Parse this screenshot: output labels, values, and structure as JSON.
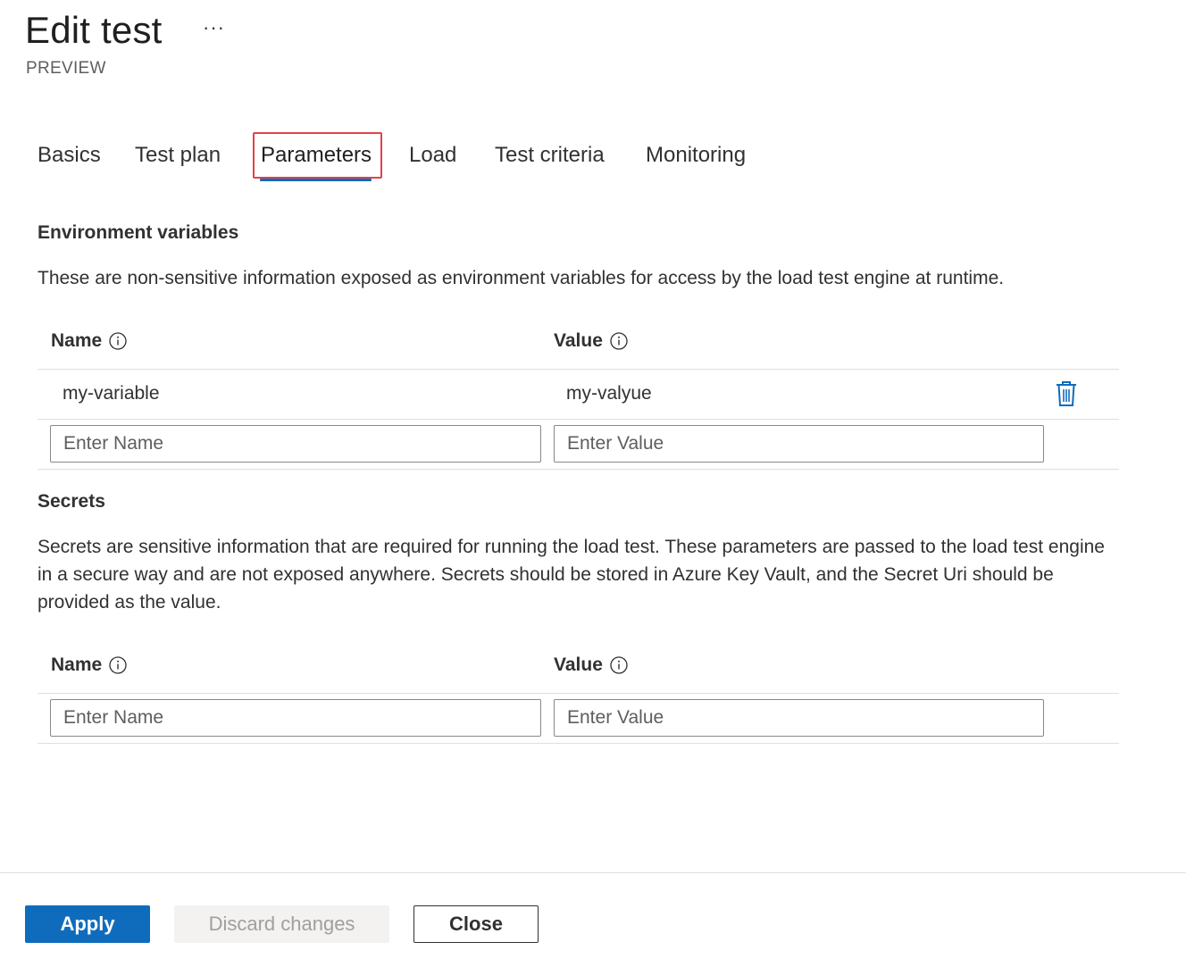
{
  "header": {
    "title": "Edit test",
    "more_label": "···",
    "subtitle": "PREVIEW"
  },
  "tabs": [
    {
      "label": "Basics",
      "active": false
    },
    {
      "label": "Test plan",
      "active": false
    },
    {
      "label": "Parameters",
      "active": true
    },
    {
      "label": "Load",
      "active": false
    },
    {
      "label": "Test criteria",
      "active": false
    },
    {
      "label": "Monitoring",
      "active": false
    }
  ],
  "env": {
    "title": "Environment variables",
    "description": "These are non-sensitive information exposed as environment variables for access by the load test engine at runtime.",
    "name_header": "Name",
    "value_header": "Value",
    "rows": [
      {
        "name": "my-variable",
        "value": "my-valyue"
      }
    ],
    "name_placeholder": "Enter Name",
    "value_placeholder": "Enter Value"
  },
  "secrets": {
    "title": "Secrets",
    "description": "Secrets are sensitive information that are required for running the load test. These parameters are passed to the load test engine in a secure way and are not exposed anywhere. Secrets should be stored in Azure Key Vault, and the Secret Uri should be provided as the value.",
    "name_header": "Name",
    "value_header": "Value",
    "name_placeholder": "Enter Name",
    "value_placeholder": "Enter Value"
  },
  "footer": {
    "apply_label": "Apply",
    "discard_label": "Discard changes",
    "close_label": "Close"
  },
  "colors": {
    "accent": "#0f6cbd",
    "highlight": "#e0424a",
    "disabled_bg": "#f3f2f1",
    "disabled_text": "#a19f9d"
  },
  "icons": {
    "info": "info-icon",
    "delete": "trash-icon"
  }
}
